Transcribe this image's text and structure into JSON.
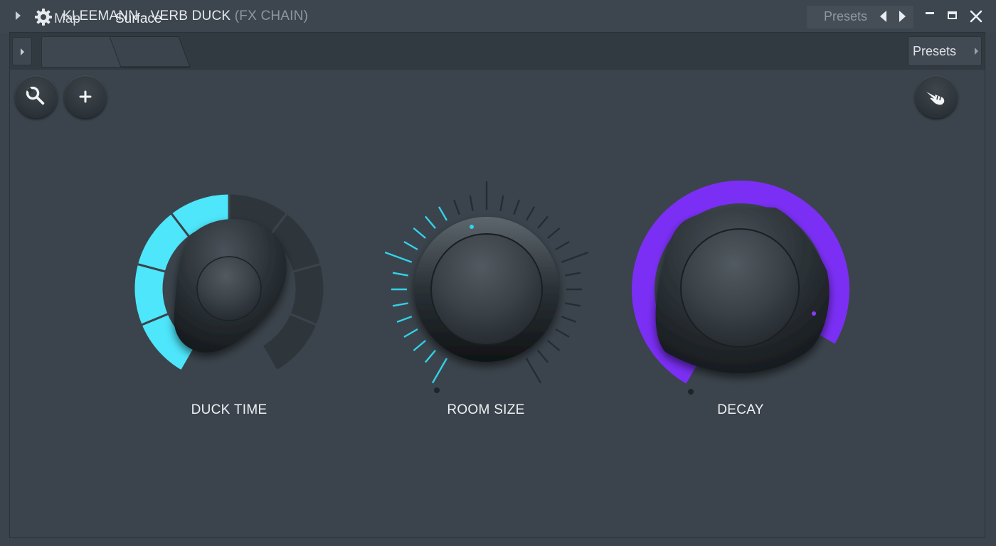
{
  "window": {
    "title": "KLEEMANN - VERB DUCK",
    "title_suffix": "(FX CHAIN)",
    "presets_label": "Presets"
  },
  "tabs": [
    {
      "label": "Map",
      "active": false
    },
    {
      "label": "Surface",
      "active": true
    }
  ],
  "presets_button": {
    "label": "Presets"
  },
  "toolbar": {
    "left_buttons": [
      "wrench-icon",
      "plus-icon"
    ],
    "right_buttons": [
      "hand-pointer-icon"
    ]
  },
  "knobs": [
    {
      "label": "DUCK TIME",
      "value": 0.5,
      "accent": "#4ee6fb"
    },
    {
      "label": "ROOM SIZE",
      "value": 0.4,
      "accent": "#33d2e8"
    },
    {
      "label": "DECAY",
      "value": 0.9,
      "accent": "#7b2ff5"
    }
  ],
  "colors": {
    "background": "#3b444c",
    "titlebar": "#3d464e",
    "tabbar": "#323a41",
    "cyan": "#4ee6fb",
    "purple": "#7b2ff5"
  }
}
